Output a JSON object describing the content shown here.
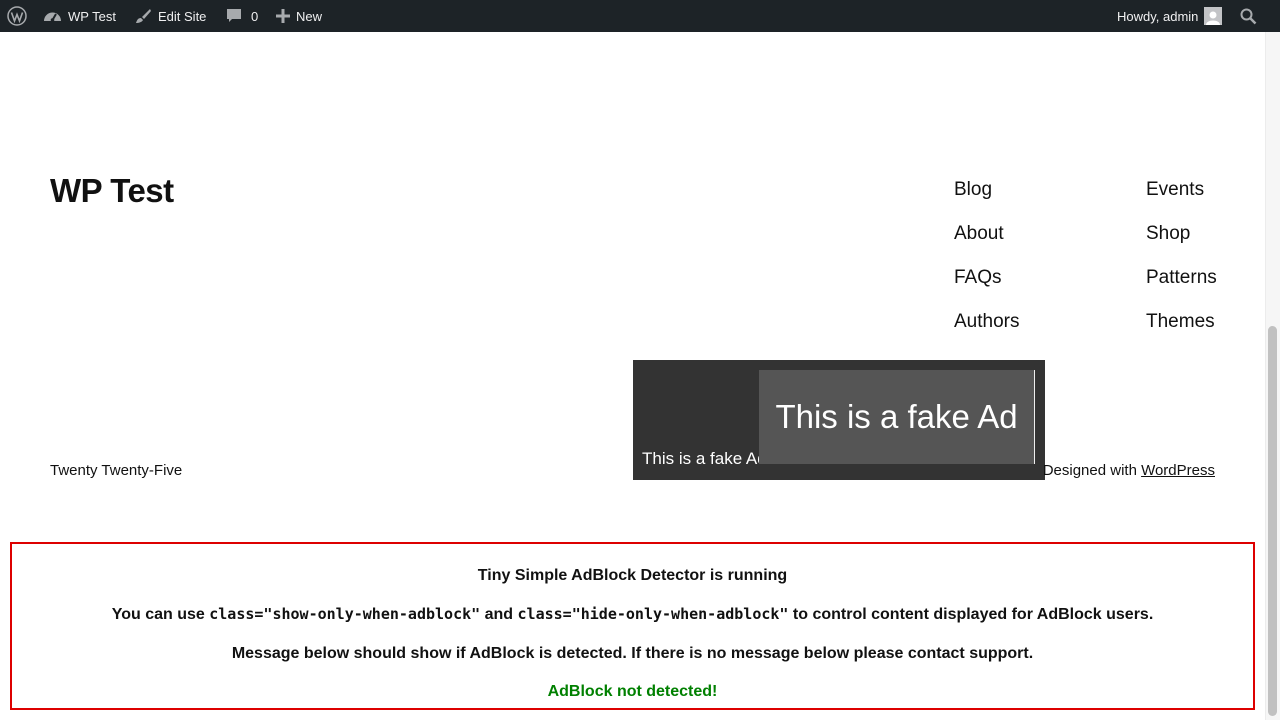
{
  "adminbar": {
    "site_name": "WP Test",
    "edit_site": "Edit Site",
    "comments_count": "0",
    "new_label": "New",
    "howdy": "Howdy, admin"
  },
  "site": {
    "title": "WP Test"
  },
  "nav": {
    "col1": [
      "Blog",
      "About",
      "FAQs",
      "Authors"
    ],
    "col2": [
      "Events",
      "Shop",
      "Patterns",
      "Themes"
    ]
  },
  "footer": {
    "theme_name": "Twenty Twenty-Five",
    "designed_with": "Designed with ",
    "wordpress_link": "WordPress"
  },
  "fake_ad": {
    "small_text": "This is a fake Ad",
    "big_text": "This is a fake Ad"
  },
  "detector": {
    "heading": "Tiny Simple AdBlock Detector is running",
    "usage_prefix": "You can use ",
    "class_show": "class=\"show-only-when-adblock\"",
    "usage_and": " and ",
    "class_hide": "class=\"hide-only-when-adblock\"",
    "usage_suffix": " to control content displayed for AdBlock users.",
    "note": "Message below should show if AdBlock is detected. If there is no message below please contact support.",
    "status": "AdBlock not detected!",
    "status_color": "#008000",
    "border_color": "#dd0000"
  },
  "colors": {
    "adminbar_bg": "#1d2327",
    "ad_bg": "#333333",
    "ad_inner_bg": "#555555"
  },
  "icons": {
    "wp_logo": "wordpress-logo-icon",
    "dashboard": "dashboard-icon",
    "edit": "brush-icon",
    "comments": "comment-icon",
    "new": "plus-icon",
    "search": "search-icon"
  }
}
